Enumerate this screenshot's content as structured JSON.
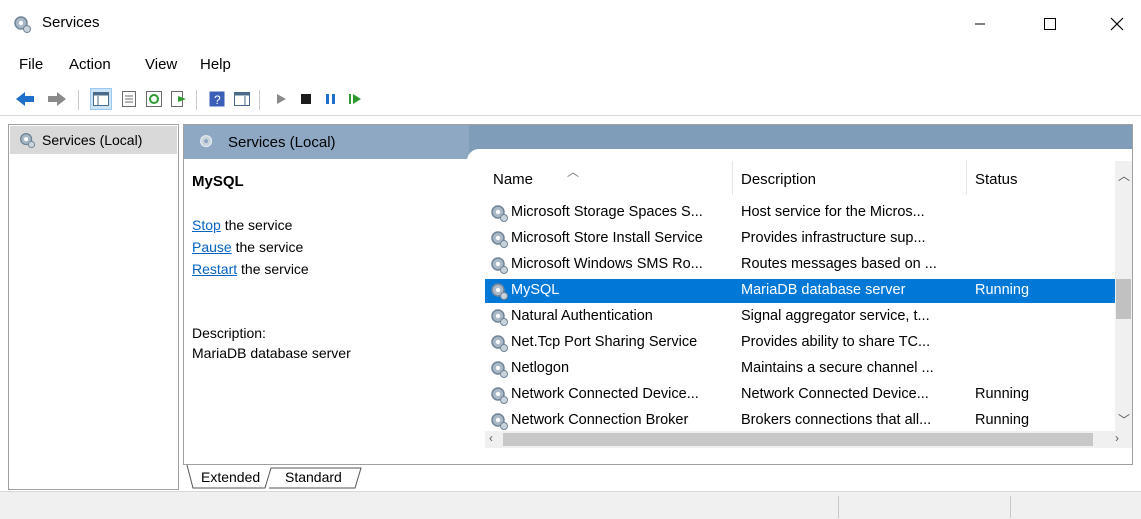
{
  "window": {
    "title": "Services"
  },
  "menu": [
    {
      "label": "File"
    },
    {
      "label": "Action"
    },
    {
      "label": "View"
    },
    {
      "label": "Help"
    }
  ],
  "tree": {
    "item": "Services (Local)"
  },
  "panel": {
    "header": "Services (Local)"
  },
  "detail": {
    "service_name": "MySQL",
    "stop_link": "Stop",
    "stop_rest": " the service",
    "pause_link": "Pause",
    "pause_rest": " the service",
    "restart_link": "Restart",
    "restart_rest": " the service",
    "description_label": "Description:",
    "description": "MariaDB database server"
  },
  "columns": {
    "name": "Name",
    "description": "Description",
    "status": "Status"
  },
  "rows": [
    {
      "name": "Microsoft Storage Spaces S...",
      "description": "Host service for the Micros...",
      "status": ""
    },
    {
      "name": "Microsoft Store Install Service",
      "description": "Provides infrastructure sup...",
      "status": ""
    },
    {
      "name": "Microsoft Windows SMS Ro...",
      "description": "Routes messages based on ...",
      "status": ""
    },
    {
      "name": "MySQL",
      "description": "MariaDB database server",
      "status": "Running"
    },
    {
      "name": "Natural Authentication",
      "description": "Signal aggregator service, t...",
      "status": ""
    },
    {
      "name": "Net.Tcp Port Sharing Service",
      "description": "Provides ability to share TC...",
      "status": ""
    },
    {
      "name": "Netlogon",
      "description": "Maintains a secure channel ...",
      "status": ""
    },
    {
      "name": "Network Connected Device...",
      "description": "Network Connected Device...",
      "status": "Running"
    },
    {
      "name": "Network Connection Broker",
      "description": "Brokers connections that all...",
      "status": "Running"
    }
  ],
  "tabs": {
    "extended": "Extended",
    "standard": "Standard"
  },
  "colors": {
    "selection": "#0078d7",
    "header": "#7f9db9",
    "link": "#0563c1"
  }
}
